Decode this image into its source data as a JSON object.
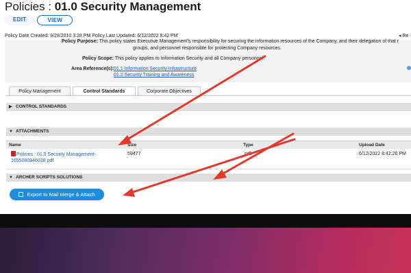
{
  "header": {
    "title_prefix": "Policies : ",
    "title": "01.0 Security Management",
    "edit_label": "EDIT",
    "view_label": "VIEW"
  },
  "meta": {
    "text": "Policy Date Created: 9/28/2010 3:28 PM Policy Last Updated: 6/12/2022 8:42 PM",
    "right_text": "◂ Re"
  },
  "policy": {
    "purpose_label": "Policy Purpose:",
    "purpose_line1": "This policy states Executive Management's responsibility for securing the information resources of the Company, and their delegation of that r",
    "purpose_line2": "groups, and personnel responsible for protecting Company resources.",
    "scope_label": "Policy Scope:",
    "scope_text": "This policy applies to Information Security and all Company personnel.",
    "area_label": "Area Reference(s):",
    "area_links": [
      "01.1 Information Security Infrastructure",
      "01.2 Security Training and Awareness"
    ]
  },
  "tabs": [
    {
      "label": "Policy Management",
      "active": false
    },
    {
      "label": "Control Standards",
      "active": true
    },
    {
      "label": "Corporate Objectives",
      "active": false
    }
  ],
  "sections": {
    "control_standards": "CONTROL STANDARDS",
    "attachments": "ATTACHMENTS",
    "archer_scripts": "ARCHER SCRIPTS SOLUTIONS"
  },
  "attachments": {
    "columns": [
      "Name",
      "Size",
      "Type",
      "Upload Date"
    ],
    "rows": [
      {
        "name_line1": "Policies : 01.0 Security Management-",
        "name_line2": "1655080946038.pdf",
        "size": "59477",
        "type": ".pdf",
        "upload_date": "6/12/2022 8:42:26 PM"
      }
    ]
  },
  "export_button": "Export to Mail Merge & Attach",
  "colors": {
    "accent": "#1e8ddb",
    "link": "#1c5fb6",
    "arrow": "#e03a2f"
  }
}
